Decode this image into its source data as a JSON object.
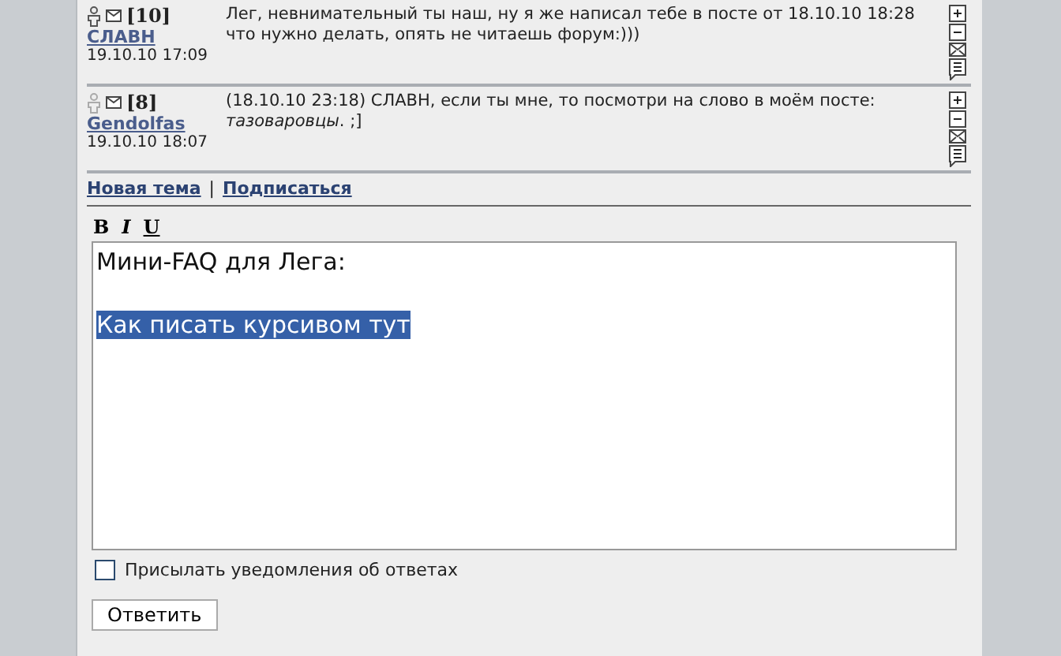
{
  "posts": [
    {
      "number": "[10]",
      "author": "СЛАВН",
      "date": "19.10.10 17:09",
      "online": true,
      "text": "Лег, невнимательный ты наш, ну я же написал тебе в посте от 18.10.10 18:28 что нужно делать, опять не читаешь форум:)))"
    },
    {
      "number": "[8]",
      "author": "Gendolfas",
      "date": "19.10.10 18:07",
      "online": false,
      "text": "(18.10.10 23:18) СЛАВН, если ты мне, то посмотри на слово в моём посте: *тазоваровцы*. ;]"
    }
  ],
  "links": [
    "Новая тема",
    "Подписаться"
  ],
  "link_separator": "|",
  "format_buttons": [
    {
      "kind": "bold",
      "label": "B"
    },
    {
      "kind": "italic",
      "label": "I"
    },
    {
      "kind": "underline",
      "label": "U"
    }
  ],
  "editor": {
    "lines": [
      {
        "text": "Мини-FAQ для Лега:",
        "selected": false
      },
      {
        "text": "Как писать курсивом тут",
        "selected": true
      }
    ]
  },
  "notify": {
    "label": "Присылать уведомления об ответах",
    "checked": false
  },
  "submit": "Ответить"
}
